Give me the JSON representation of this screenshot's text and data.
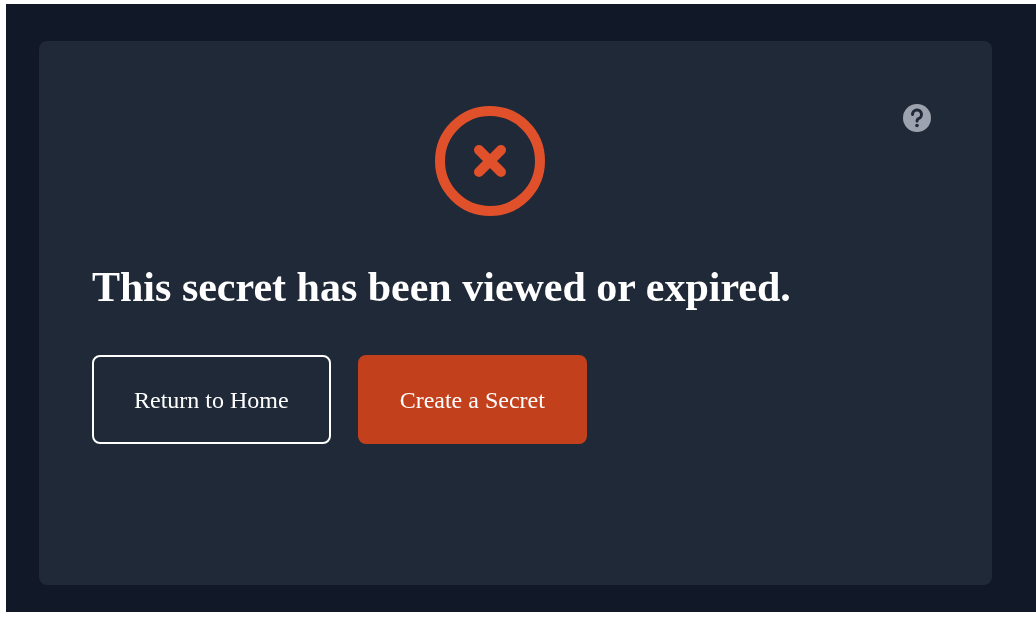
{
  "message": {
    "heading": "This secret has been viewed or expired."
  },
  "buttons": [
    {
      "label": "Return to Home",
      "kind": "outline"
    },
    {
      "label": "Create a Secret",
      "kind": "primary"
    }
  ]
}
